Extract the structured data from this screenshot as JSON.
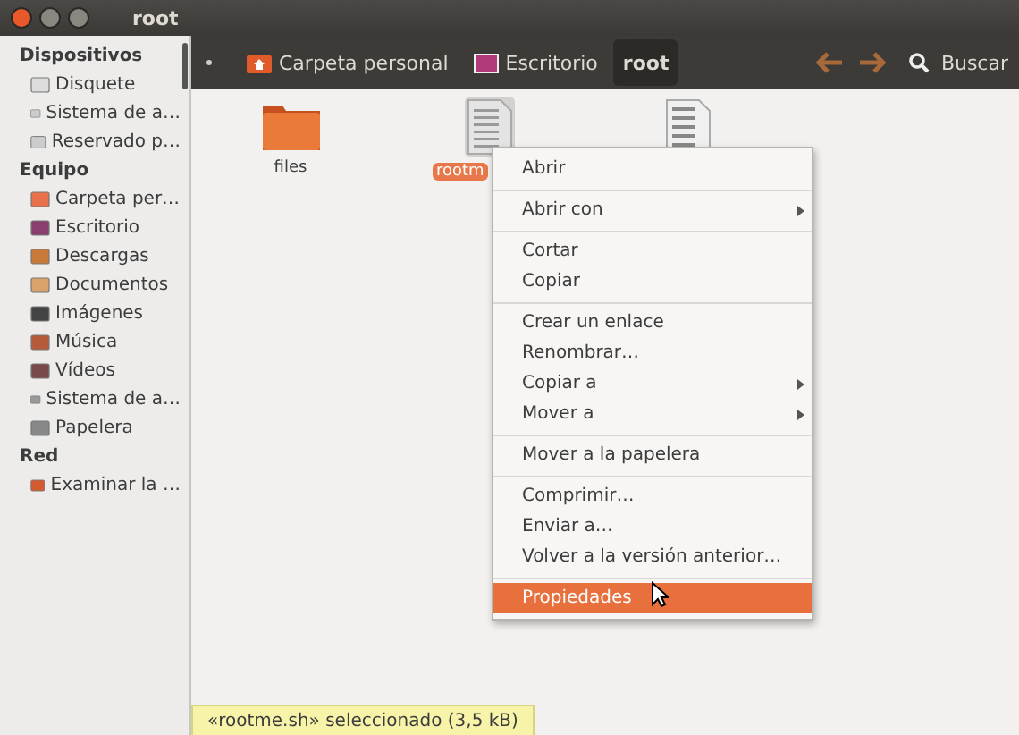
{
  "window": {
    "title": "root"
  },
  "sidebar": {
    "sections": [
      {
        "title": "Dispositivos",
        "items": [
          {
            "label": "Disquete"
          },
          {
            "label": "Sistema de a…"
          },
          {
            "label": "Reservado p…"
          }
        ]
      },
      {
        "title": "Equipo",
        "items": [
          {
            "label": "Carpeta per…"
          },
          {
            "label": "Escritorio"
          },
          {
            "label": "Descargas"
          },
          {
            "label": "Documentos"
          },
          {
            "label": "Imágenes"
          },
          {
            "label": "Música"
          },
          {
            "label": "Vídeos"
          },
          {
            "label": "Sistema de a…"
          },
          {
            "label": "Papelera"
          }
        ]
      },
      {
        "title": "Red",
        "items": [
          {
            "label": "Examinar la …"
          }
        ]
      }
    ]
  },
  "breadcrumbs": [
    {
      "label": "Carpeta personal",
      "selected": false
    },
    {
      "label": "Escritorio",
      "selected": false
    },
    {
      "label": "root",
      "selected": true
    }
  ],
  "search": {
    "label": "Buscar"
  },
  "files": [
    {
      "kind": "folder",
      "name": "files",
      "selected": false
    },
    {
      "kind": "text",
      "name": "rootm",
      "selected": true
    },
    {
      "kind": "script",
      "selected": false
    }
  ],
  "context_menu": [
    {
      "kind": "item",
      "label": "Abrir",
      "submenu": false,
      "selected": false
    },
    {
      "kind": "separator"
    },
    {
      "kind": "item",
      "label": "Abrir con",
      "submenu": true,
      "selected": false
    },
    {
      "kind": "separator"
    },
    {
      "kind": "item",
      "label": "Cortar",
      "submenu": false,
      "selected": false
    },
    {
      "kind": "item",
      "label": "Copiar",
      "submenu": false,
      "selected": false
    },
    {
      "kind": "separator"
    },
    {
      "kind": "item",
      "label": "Crear un enlace",
      "submenu": false,
      "selected": false
    },
    {
      "kind": "item",
      "label": "Renombrar…",
      "submenu": false,
      "selected": false
    },
    {
      "kind": "item",
      "label": "Copiar a",
      "submenu": true,
      "selected": false
    },
    {
      "kind": "item",
      "label": "Mover a",
      "submenu": true,
      "selected": false
    },
    {
      "kind": "separator"
    },
    {
      "kind": "item",
      "label": "Mover a la papelera",
      "submenu": false,
      "selected": false
    },
    {
      "kind": "separator"
    },
    {
      "kind": "item",
      "label": "Comprimir…",
      "submenu": false,
      "selected": false
    },
    {
      "kind": "item",
      "label": "Enviar a…",
      "submenu": false,
      "selected": false
    },
    {
      "kind": "item",
      "label": "Volver a la versión anterior…",
      "submenu": false,
      "selected": false
    },
    {
      "kind": "separator"
    },
    {
      "kind": "item",
      "label": "Propiedades",
      "submenu": false,
      "selected": true
    }
  ],
  "status": "«rootme.sh» seleccionado (3,5 kB)"
}
